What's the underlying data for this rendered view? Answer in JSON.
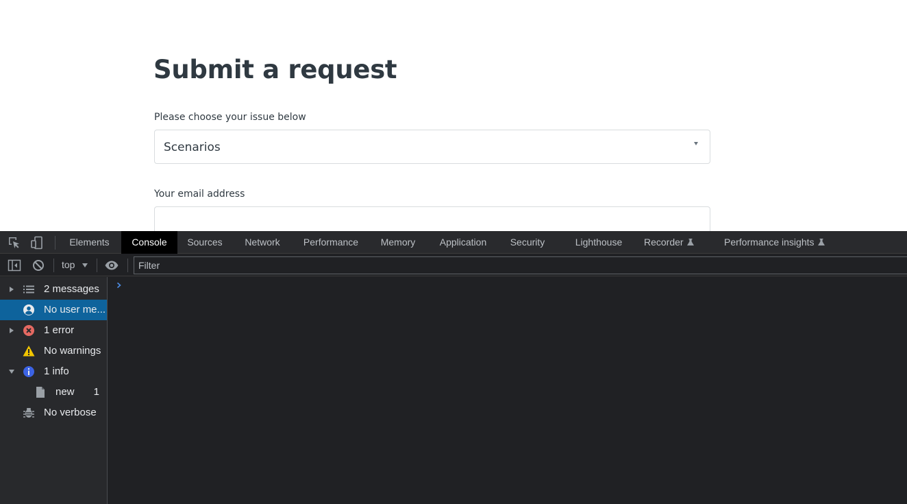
{
  "page": {
    "title": "Submit a request",
    "issue_label": "Please choose your issue below",
    "issue_value": "Scenarios",
    "email_label": "Your email address",
    "email_value": ""
  },
  "devtools": {
    "tabs": [
      {
        "label": "Elements"
      },
      {
        "label": "Console",
        "active": true
      },
      {
        "label": "Sources"
      },
      {
        "label": "Network"
      },
      {
        "label": "Performance"
      },
      {
        "label": "Memory"
      },
      {
        "label": "Application"
      },
      {
        "label": "Security"
      },
      {
        "label": "Lighthouse"
      },
      {
        "label": "Recorder",
        "experimental": true
      },
      {
        "label": "Performance insights",
        "experimental": true
      }
    ],
    "toolbar": {
      "context": "top",
      "filter_placeholder": "Filter"
    },
    "sidebar": [
      {
        "label": "2 messages",
        "icon": "list-icon",
        "expand": "collapsed"
      },
      {
        "label": "No user me...",
        "icon": "user-icon",
        "selected": true
      },
      {
        "label": "1 error",
        "icon": "error-icon",
        "expand": "collapsed"
      },
      {
        "label": "No warnings",
        "icon": "warning-icon"
      },
      {
        "label": "1 info",
        "icon": "info-icon",
        "expand": "expanded"
      },
      {
        "label": "new",
        "icon": "file-icon",
        "count": "1"
      },
      {
        "label": "No verbose",
        "icon": "bug-icon"
      }
    ],
    "colors": {
      "selected": "#0e639c",
      "error": "#e46962",
      "warning": "#f2c500",
      "info": "#3c63e4",
      "prompt": "#4d8ee6"
    }
  }
}
